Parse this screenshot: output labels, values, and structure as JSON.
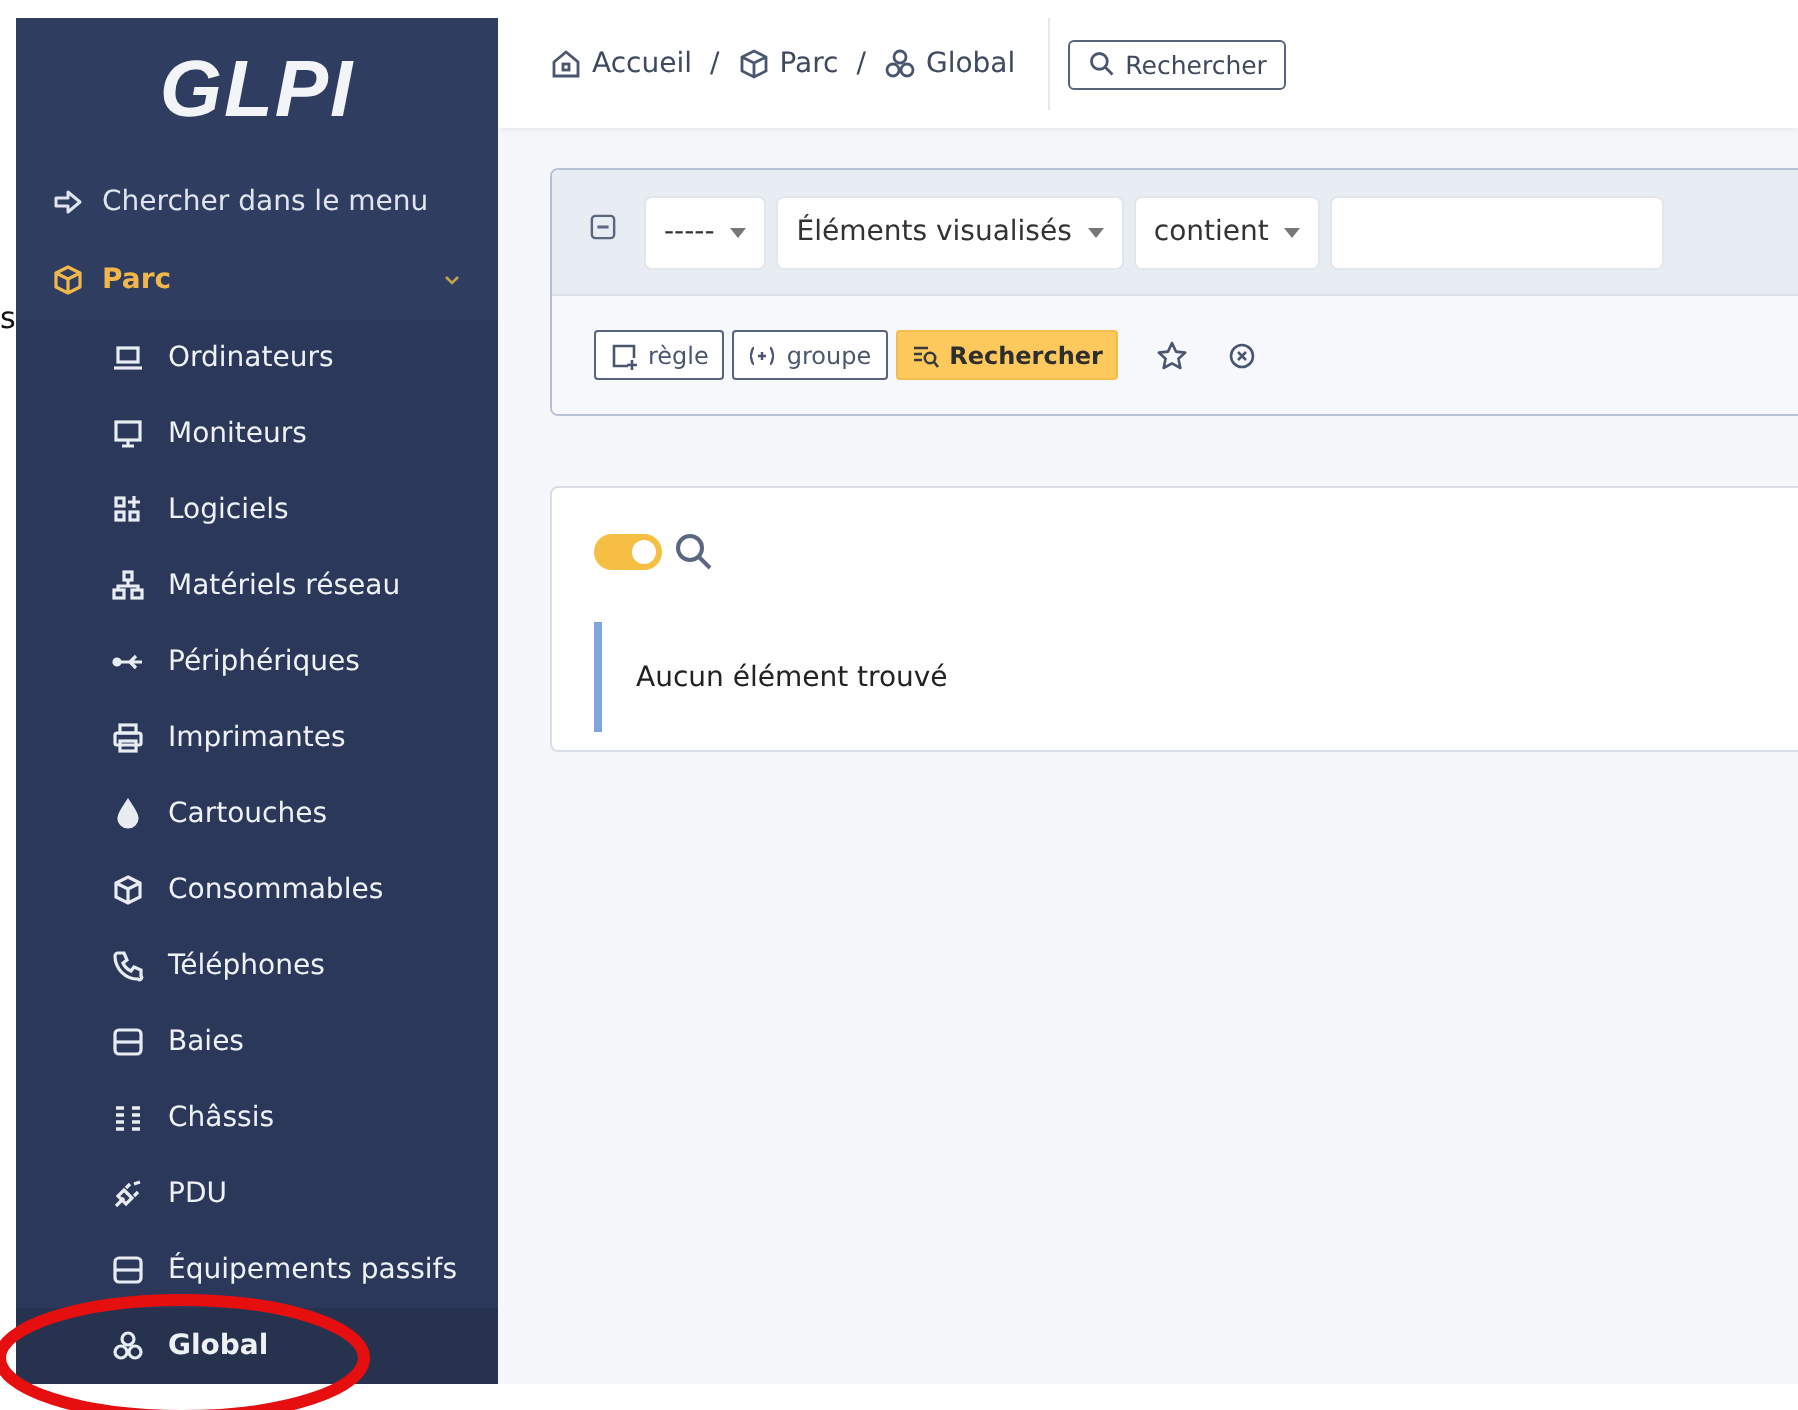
{
  "stray_text": "s",
  "sidebar": {
    "logo": "GLPI",
    "menu_search": "Chercher dans le menu",
    "section": {
      "label": "Parc",
      "expanded": true,
      "active": true
    },
    "items": [
      {
        "label": "Ordinateurs",
        "selected": false
      },
      {
        "label": "Moniteurs",
        "selected": false
      },
      {
        "label": "Logiciels",
        "selected": false
      },
      {
        "label": "Matériels réseau",
        "selected": false
      },
      {
        "label": "Périphériques",
        "selected": false
      },
      {
        "label": "Imprimantes",
        "selected": false
      },
      {
        "label": "Cartouches",
        "selected": false
      },
      {
        "label": "Consommables",
        "selected": false
      },
      {
        "label": "Téléphones",
        "selected": false
      },
      {
        "label": "Baies",
        "selected": false
      },
      {
        "label": "Châssis",
        "selected": false
      },
      {
        "label": "PDU",
        "selected": false
      },
      {
        "label": "Équipements passifs",
        "selected": false
      },
      {
        "label": "Global",
        "selected": true
      }
    ]
  },
  "breadcrumb": [
    {
      "label": "Accueil"
    },
    {
      "separator": "/",
      "label": "Parc"
    },
    {
      "separator": "/",
      "label": "Global"
    }
  ],
  "header_search": "Rechercher",
  "criteria": {
    "selects": [
      "-----",
      "Éléments visualisés",
      "contient"
    ],
    "buttons": [
      {
        "kind": "rule",
        "label": "règle"
      },
      {
        "kind": "group",
        "label": "groupe"
      },
      {
        "kind": "search",
        "label": "Rechercher"
      }
    ]
  },
  "results": {
    "toggle_on": true,
    "message": "Aucun élément trouvé"
  }
}
